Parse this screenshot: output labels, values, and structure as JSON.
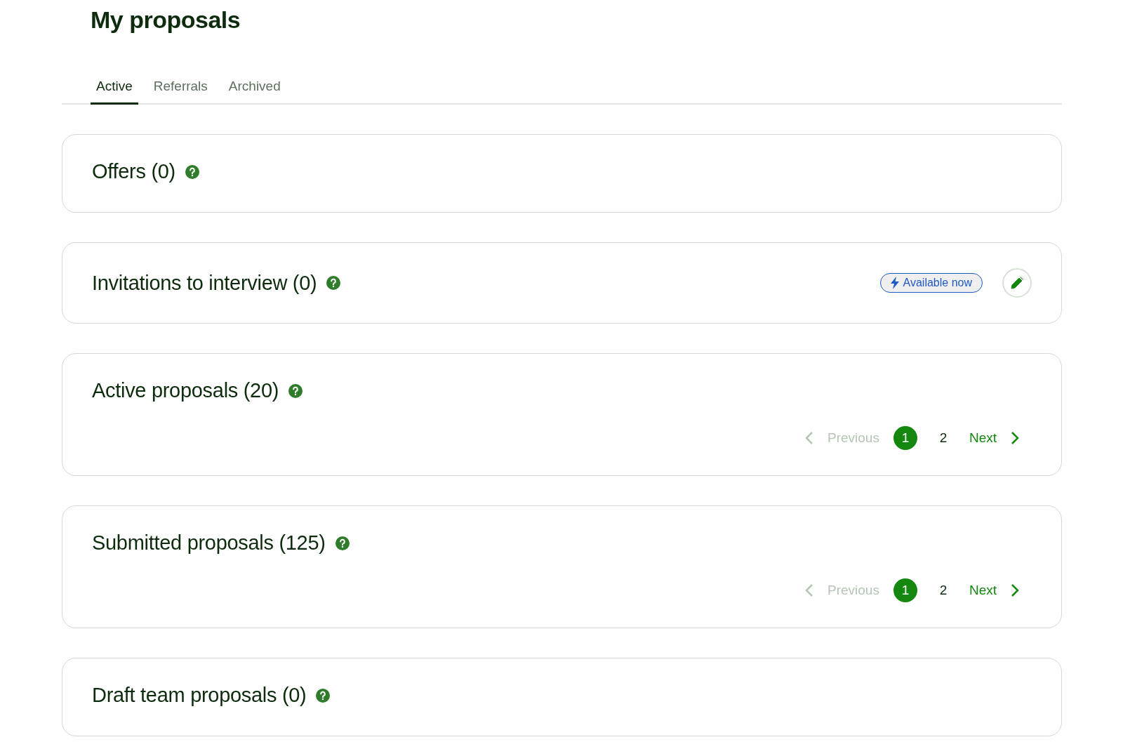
{
  "page_title": "My proposals",
  "tabs": [
    {
      "label": "Active",
      "selected": true
    },
    {
      "label": "Referrals",
      "selected": false
    },
    {
      "label": "Archived",
      "selected": false
    }
  ],
  "sections": [
    {
      "title": "Offers (0)"
    },
    {
      "title": "Invitations to interview (0)",
      "availability_badge": "Available now"
    },
    {
      "title": "Active proposals (20)",
      "pagination": {
        "previous": {
          "label": "Previous",
          "disabled": true
        },
        "pages": [
          {
            "label": "1",
            "selected": true
          },
          {
            "label": "2",
            "selected": false
          }
        ],
        "next": {
          "label": "Next",
          "disabled": false
        }
      }
    },
    {
      "title": "Submitted proposals (125)",
      "pagination": {
        "previous": {
          "label": "Previous",
          "disabled": true
        },
        "pages": [
          {
            "label": "1",
            "selected": true
          },
          {
            "label": "2",
            "selected": false
          }
        ],
        "next": {
          "label": "Next",
          "disabled": false
        }
      }
    },
    {
      "title": "Draft team proposals (0)"
    }
  ]
}
